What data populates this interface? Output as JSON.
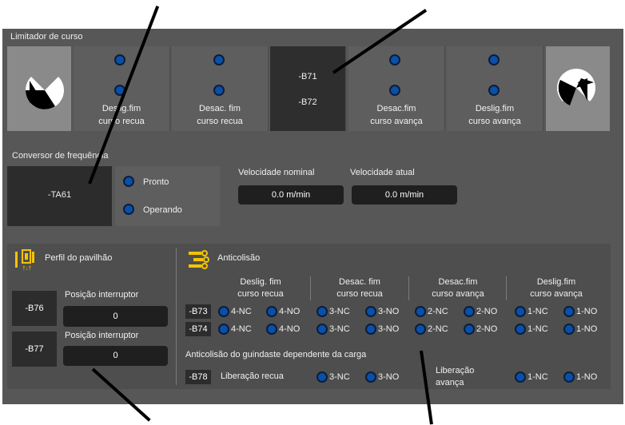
{
  "limit_switch": {
    "title": "Limitador de curso",
    "cells": [
      {
        "label": "Deslig.fim\ncurso recua"
      },
      {
        "label": "Desac. fim\ncurso recua"
      },
      {
        "codes": [
          "-B71",
          "-B72"
        ]
      },
      {
        "label": "Desac.fim\ncurso avança"
      },
      {
        "label": "Deslig.fim\ncurso avança"
      }
    ]
  },
  "converter": {
    "title": "Conversor de frequência",
    "device": "-TA61",
    "ready_label": "Pronto",
    "operating_label": "Operando",
    "nominal_speed_label": "Velocidade nominal",
    "nominal_speed_value": "0.0 m/min",
    "actual_speed_label": "Velocidade atual",
    "actual_speed_value": "0.0 m/min"
  },
  "profile": {
    "title": "Perfil do pavilhão",
    "rows": [
      {
        "code": "-B76",
        "label": "Posição interruptor",
        "value": "0"
      },
      {
        "code": "-B77",
        "label": "Posição interruptor",
        "value": "0"
      }
    ]
  },
  "anticollision": {
    "title": "Anticolisão",
    "columns": [
      "Deslig. fim\ncurso recua",
      "Desac. fim\ncurso recua",
      "Desac.fim\ncurso avança",
      "Deslig.fim\ncurso avança"
    ],
    "rows": [
      {
        "code": "-B73",
        "contacts": [
          "4-NC",
          "4-NO",
          "3-NC",
          "3-NO",
          "2-NC",
          "2-NO",
          "1-NC",
          "1-NO"
        ]
      },
      {
        "code": "-B74",
        "contacts": [
          "4-NC",
          "4-NO",
          "3-NC",
          "3-NO",
          "2-NC",
          "2-NO",
          "1-NC",
          "1-NO"
        ]
      }
    ],
    "load_title": "Anticolisão do guindaste dependente da carga",
    "load_code": "-B78",
    "release_back_label": "Liberação recua",
    "release_back_contacts": [
      "3-NC",
      "3-NO"
    ],
    "release_fwd_label": "Liberação\navança",
    "release_fwd_contacts": [
      "1-NC",
      "1-NO"
    ]
  },
  "colors": {
    "panel": "#575757",
    "led": "#0a4fa8",
    "accent": "#f5c400",
    "dark_box": "#2c2c2c"
  }
}
